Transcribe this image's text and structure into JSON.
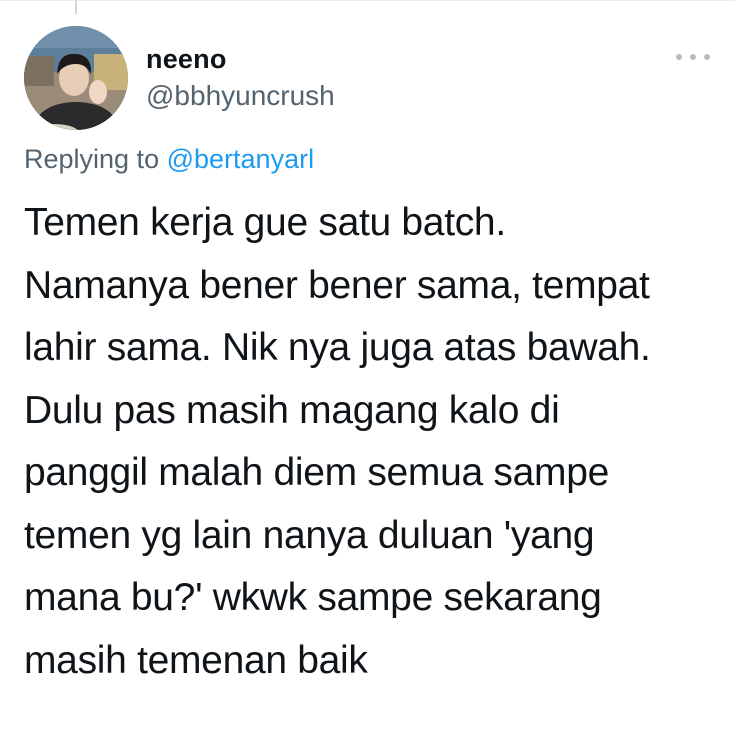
{
  "tweet": {
    "author": {
      "display_name": "neeno",
      "handle": "@bbhyuncrush",
      "avatar_icon": "profile-photo"
    },
    "more_icon": "more-horizontal-icon",
    "reply": {
      "prefix": "Replying to",
      "mention": "@bertanyarl"
    },
    "text_lines": [
      "Temen kerja gue satu batch.",
      "Namanya bener bener sama, tempat",
      "lahir sama. Nik nya juga atas bawah.",
      "Dulu pas masih magang kalo di",
      "panggil malah diem semua sampe",
      "temen yg lain nanya duluan 'yang",
      "mana bu?' wkwk sampe sekarang",
      "masih temenan baik"
    ]
  },
  "colors": {
    "text_primary": "#0f1419",
    "text_secondary": "#536471",
    "link": "#1d9bf0",
    "border": "#e6ecf0"
  }
}
